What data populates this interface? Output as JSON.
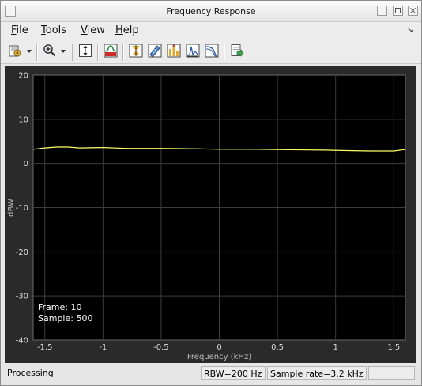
{
  "window": {
    "title": "Frequency Response"
  },
  "menu": {
    "items": [
      {
        "first": "F",
        "rest": "ile"
      },
      {
        "first": "T",
        "rest": "ools"
      },
      {
        "first": "V",
        "rest": "iew"
      },
      {
        "first": "H",
        "rest": "elp"
      }
    ]
  },
  "toolbar": {
    "tools": [
      "print-settings-icon",
      "zoom-in-icon",
      "autoscale-icon",
      "spectrum-icon",
      "data-cursor-icon",
      "measure-icon",
      "peak-finder-icon",
      "cursor-measurements-icon",
      "channel-measurements-icon",
      "export-icon"
    ]
  },
  "plot": {
    "frame_label": "Frame: 10",
    "sample_label": "Sample: 500",
    "trace_color": "#ffff66",
    "background": "#000000"
  },
  "chart_data": {
    "type": "line",
    "xlabel": "Frequency (kHz)",
    "ylabel": "dBW",
    "xlim": [
      -1.6,
      1.6
    ],
    "ylim": [
      -40,
      20
    ],
    "xticks": [
      -1.5,
      -1,
      -0.5,
      0,
      0.5,
      1,
      1.5
    ],
    "xtick_labels": [
      "-1.5",
      "-1",
      "-0.5",
      "0",
      "0.5",
      "1",
      "1.5"
    ],
    "yticks": [
      20,
      10,
      0,
      -10,
      -20,
      -30,
      -40
    ],
    "ytick_labels": [
      "20",
      "10",
      "0",
      "-10",
      "-20",
      "-30",
      "-40"
    ],
    "grid": true,
    "series": [
      {
        "color": "#ffff66",
        "x": [
          -1.6,
          -1.5,
          -1.4,
          -1.3,
          -1.2,
          -1.0,
          -0.8,
          -0.5,
          -0.2,
          0.0,
          0.3,
          0.6,
          0.9,
          1.1,
          1.3,
          1.5,
          1.58,
          1.6
        ],
        "y": [
          3.2,
          3.5,
          3.7,
          3.7,
          3.5,
          3.6,
          3.4,
          3.4,
          3.3,
          3.2,
          3.2,
          3.1,
          3.0,
          2.9,
          2.8,
          2.8,
          3.1,
          3.1
        ]
      }
    ]
  },
  "status": {
    "main": "Processing",
    "rbw": "RBW=200 Hz",
    "sample_rate": "Sample rate=3.2 kHz"
  }
}
